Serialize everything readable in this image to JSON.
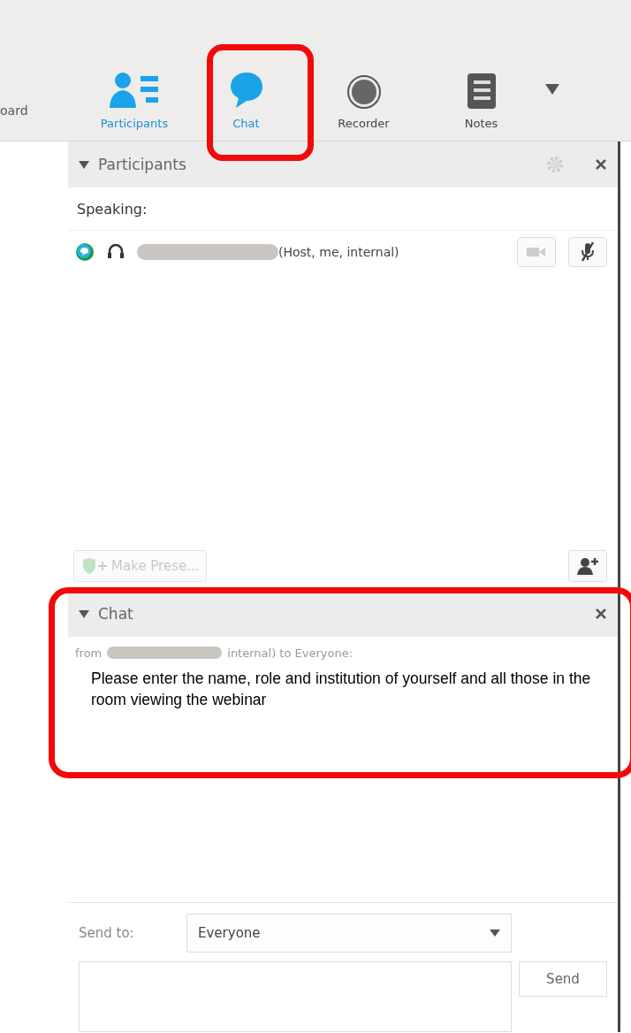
{
  "toolbar": {
    "cut_tab": "oard",
    "tabs": [
      {
        "kind": "participants",
        "label": "Participants",
        "active": true,
        "highlighted": false
      },
      {
        "kind": "chat",
        "label": "Chat",
        "active": true,
        "highlighted": true
      },
      {
        "kind": "recorder",
        "label": "Recorder",
        "active": false,
        "highlighted": false
      },
      {
        "kind": "notes",
        "label": "Notes",
        "active": false,
        "highlighted": false
      }
    ]
  },
  "participants_panel": {
    "title": "Participants",
    "expanded": true,
    "speaking_label": "Speaking:",
    "participants": [
      {
        "role": "(Host, me, internal)",
        "video_on": false,
        "muted": true
      }
    ],
    "make_presenter": {
      "label": "Make Prese...",
      "disabled": true
    }
  },
  "chat_panel": {
    "title": "Chat",
    "expanded": true,
    "highlighted": true,
    "messages": [
      {
        "from": "from",
        "to": "internal) to Everyone:",
        "text": "Please enter the name, role and institution of yourself and all those in the room viewing the webinar"
      }
    ],
    "send_to_label": "Send to:",
    "send_to_value": "Everyone",
    "send_button": "Send"
  }
}
